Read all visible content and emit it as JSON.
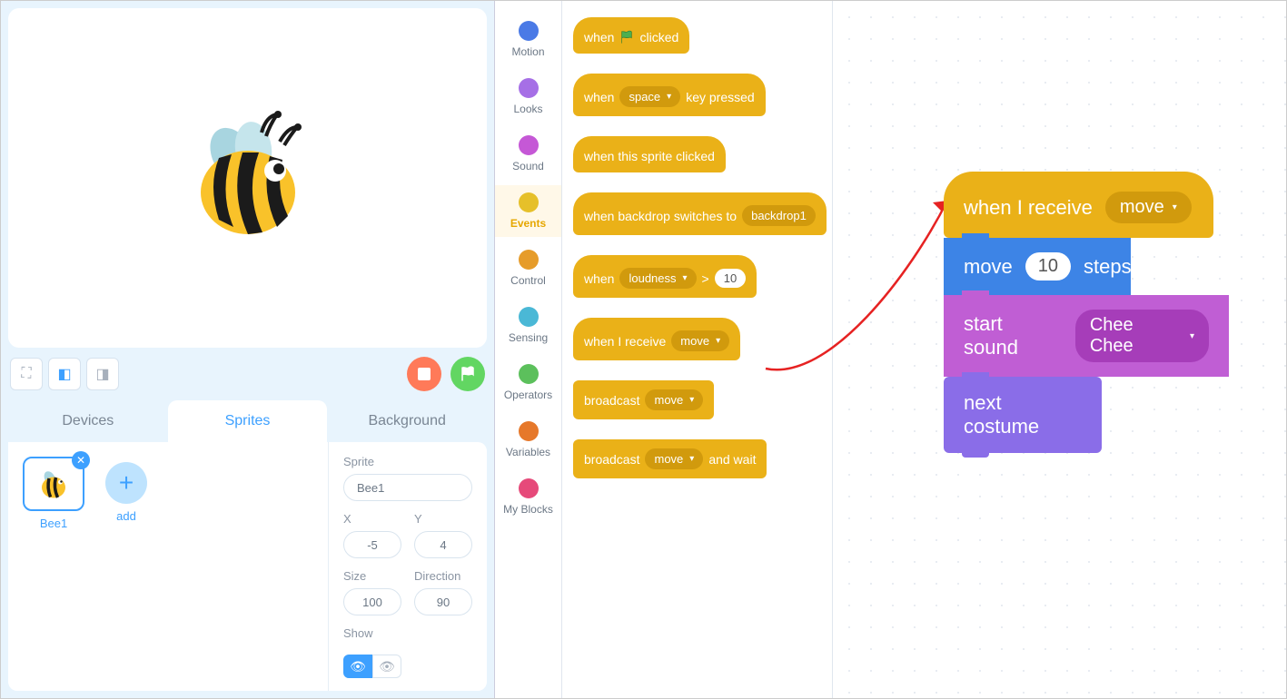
{
  "tabs": {
    "devices": "Devices",
    "sprites": "Sprites",
    "background": "Background"
  },
  "sprite_list": {
    "selected": {
      "name": "Bee1"
    },
    "add_label": "add"
  },
  "sprite_props": {
    "sprite_label": "Sprite",
    "name_value": "Bee1",
    "x_label": "X",
    "x_value": "-5",
    "y_label": "Y",
    "y_value": "4",
    "size_label": "Size",
    "size_value": "100",
    "dir_label": "Direction",
    "dir_value": "90",
    "show_label": "Show"
  },
  "categories": [
    {
      "name": "Motion",
      "color": "#4a7ae6"
    },
    {
      "name": "Looks",
      "color": "#a66fe6"
    },
    {
      "name": "Sound",
      "color": "#c558d6"
    },
    {
      "name": "Events",
      "color": "#e6c02a",
      "active": true
    },
    {
      "name": "Control",
      "color": "#e69c2a"
    },
    {
      "name": "Sensing",
      "color": "#4ab8d6"
    },
    {
      "name": "Operators",
      "color": "#5cc05c"
    },
    {
      "name": "Variables",
      "color": "#e6782a"
    },
    {
      "name": "My Blocks",
      "color": "#e64a7a"
    }
  ],
  "palette": {
    "when_flag": {
      "pre": "when",
      "post": "clicked"
    },
    "when_key": {
      "pre": "when",
      "key": "space",
      "post": "key pressed"
    },
    "when_clicked": "when this sprite clicked",
    "when_backdrop": {
      "pre": "when backdrop switches to",
      "val": "backdrop1"
    },
    "when_loudness": {
      "pre": "when",
      "param": "loudness",
      "op": ">",
      "val": "10"
    },
    "when_receive": {
      "pre": "when I receive",
      "msg": "move"
    },
    "broadcast": {
      "pre": "broadcast",
      "msg": "move"
    },
    "broadcast_wait": {
      "pre": "broadcast",
      "msg": "move",
      "post": "and wait"
    }
  },
  "script": {
    "when_receive": {
      "pre": "when I receive",
      "msg": "move"
    },
    "move": {
      "pre": "move",
      "val": "10",
      "post": "steps"
    },
    "sound": {
      "pre": "start sound",
      "val": "Chee Chee"
    },
    "next_costume": "next costume"
  }
}
